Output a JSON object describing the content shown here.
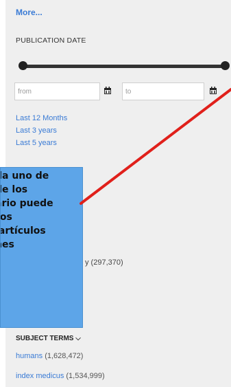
{
  "sidebar": {
    "more_label": "More...",
    "publication_date": {
      "title": "PUBLICATION DATE",
      "from_placeholder": "from",
      "to_placeholder": "to",
      "quick_links": [
        "Last 12 Months",
        "Last 3 years",
        "Last 5 years"
      ]
    },
    "partial_count": "y (297,370)",
    "subject_terms": {
      "header": "SUBJECT TERMS ⌵",
      "items": [
        {
          "term": "humans",
          "count": "(1,628,472)"
        },
        {
          "term": "index medicus",
          "count": "(1,534,999)"
        }
      ]
    }
  },
  "callout": {
    "text": "da uno de\nde los\nario puede\nros\n artículos\nnes"
  },
  "colors": {
    "panel_bg": "#efefef",
    "link": "#3a7bd5",
    "callout_bg": "#5da5e8",
    "arrow": "#e0201b"
  }
}
